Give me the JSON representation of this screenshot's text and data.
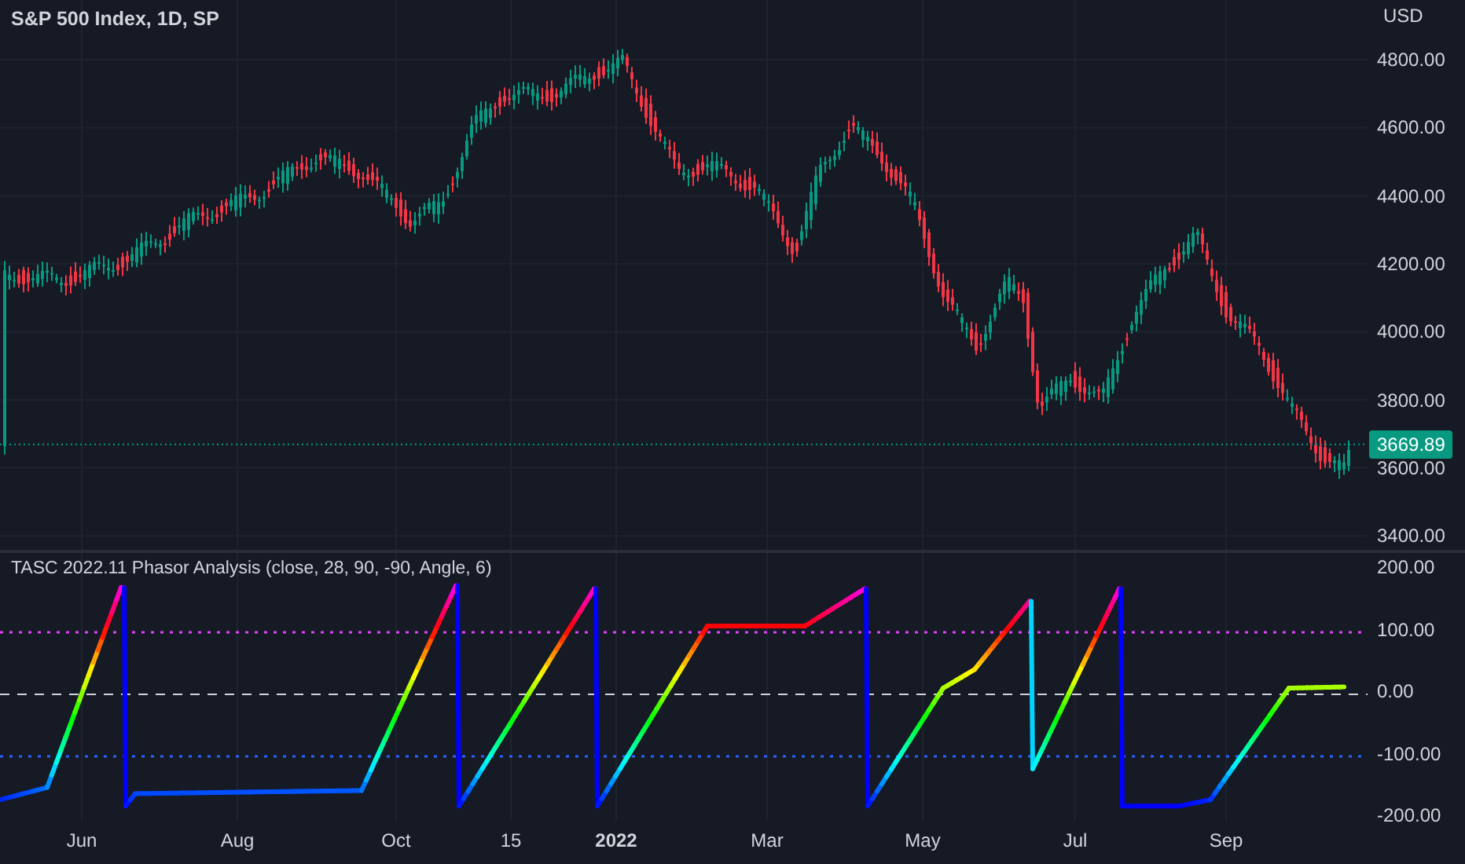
{
  "price_pane": {
    "title": "S&P 500 Index, 1D, SP",
    "currency": "USD",
    "axis_ticks": [
      "4800.00",
      "4600.00",
      "4400.00",
      "4200.00",
      "4000.00",
      "3800.00",
      "3600.00",
      "3400.00"
    ],
    "last_price": "3669.89"
  },
  "indicator_pane": {
    "title": "TASC 2022.11 Phasor Analysis (close, 28, 90, -90, Angle, 6)",
    "axis_ticks": [
      "200.00",
      "100.00",
      "0.00",
      "-100.00",
      "-200.00"
    ]
  },
  "time_axis": [
    {
      "label": "Jun",
      "bold": false
    },
    {
      "label": "Aug",
      "bold": false
    },
    {
      "label": "Oct",
      "bold": false
    },
    {
      "label": "15",
      "bold": false
    },
    {
      "label": "2022",
      "bold": true
    },
    {
      "label": "Mar",
      "bold": false
    },
    {
      "label": "May",
      "bold": false
    },
    {
      "label": "Jul",
      "bold": false
    },
    {
      "label": "Sep",
      "bold": false
    }
  ]
}
